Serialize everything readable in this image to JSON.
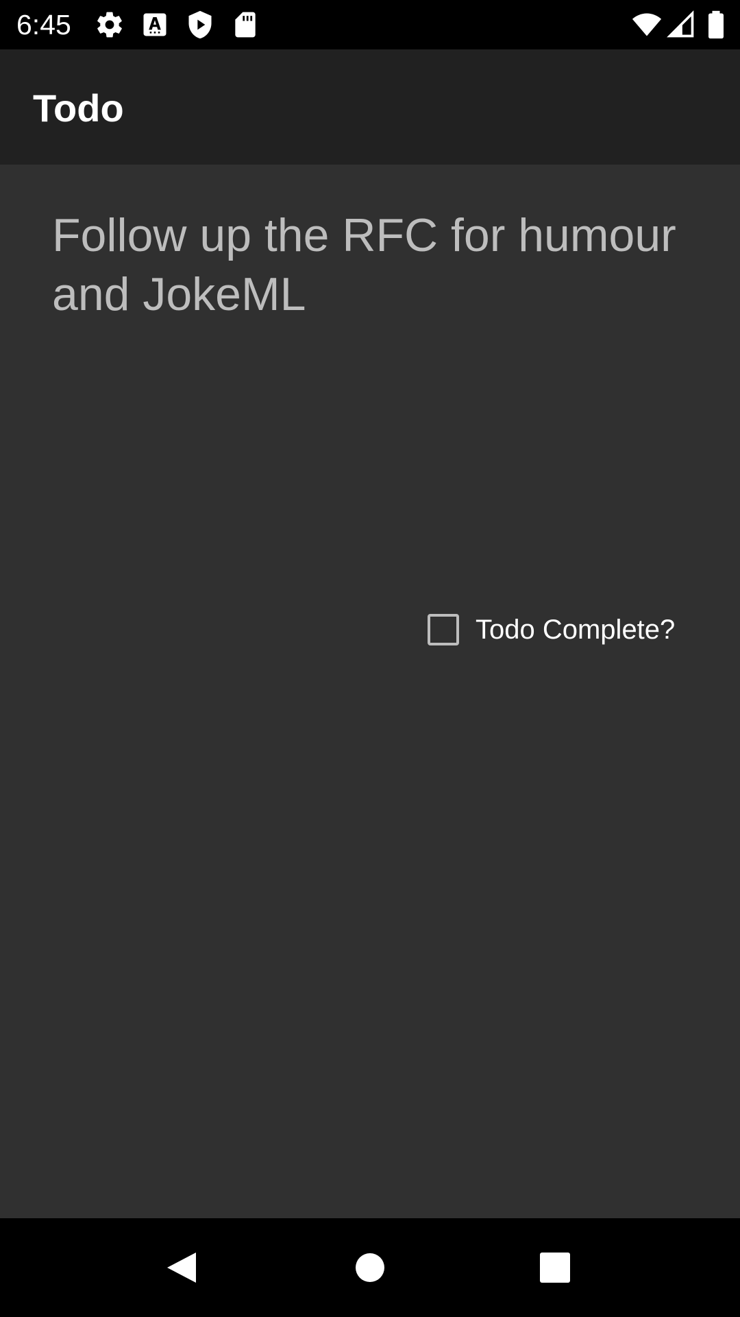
{
  "status_bar": {
    "time": "6:45",
    "icons": [
      "settings-icon",
      "a-keyboard-icon",
      "play-shield-icon",
      "sd-card-icon",
      "wifi-icon",
      "cell-signal-icon",
      "battery-icon"
    ]
  },
  "app_bar": {
    "title": "Todo"
  },
  "todo": {
    "text": "Follow up the RFC for humour and JokeML",
    "complete_label": "Todo Complete?",
    "complete_checked": false
  },
  "nav_bar": {
    "buttons": [
      "back-icon",
      "home-icon",
      "recents-icon"
    ]
  },
  "colors": {
    "status_bar_bg": "#000000",
    "app_bar_bg": "#212121",
    "content_bg": "#303030",
    "todo_text": "#bdbdbd",
    "label_text": "#ffffff"
  }
}
